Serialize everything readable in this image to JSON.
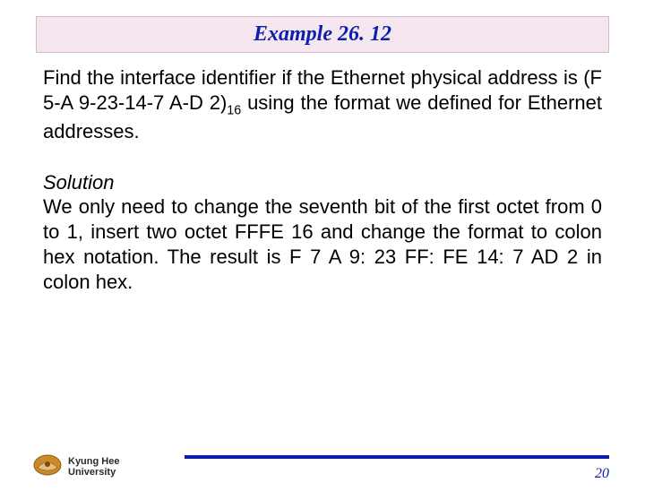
{
  "title": "Example 26. 12",
  "problem_pre": "Find the interface identifier if the Ethernet physical address is (F 5-A 9-23-14-7 A-D 2)",
  "problem_sub": "16",
  "problem_post": " using the format we defined for Ethernet addresses.",
  "solution_label": "Solution",
  "solution_text": "We only need to change the seventh bit of the first octet from 0 to 1, insert two octet FFFE 16 and change the format to colon hex notation. The result is F 7 A 9: 23 FF: FE 14: 7 AD 2 in colon hex.",
  "university_line1": "Kyung Hee",
  "university_line2": "University",
  "page_number": "20"
}
